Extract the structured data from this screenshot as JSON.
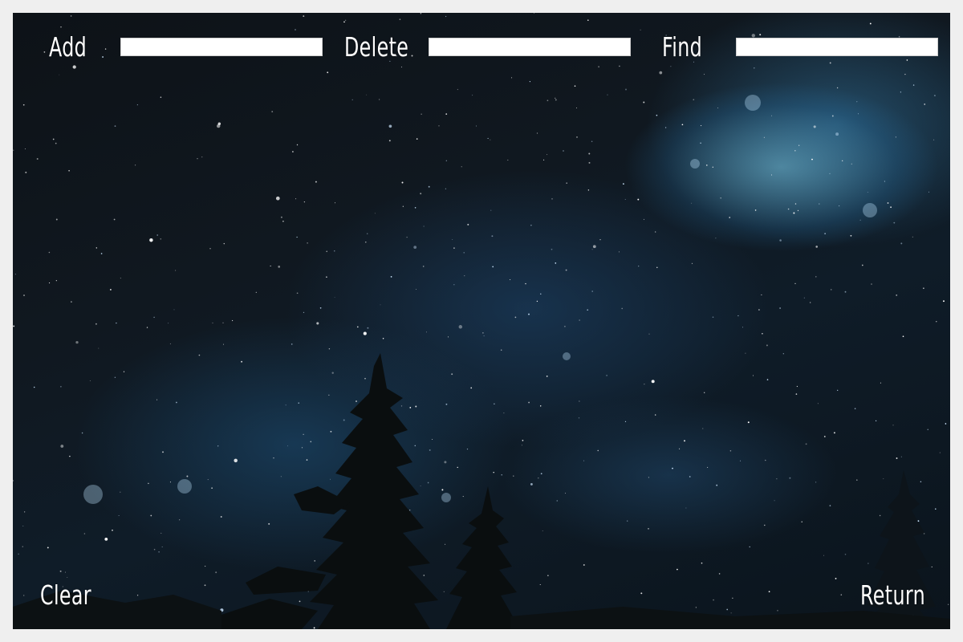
{
  "toolbar": {
    "add_label": "Add",
    "add_value": "",
    "delete_label": "Delete",
    "delete_value": "",
    "find_label": "Find",
    "find_value": ""
  },
  "footer": {
    "clear_label": "Clear",
    "return_label": "Return"
  },
  "colors": {
    "page_border": "#efefef",
    "sky_dark": "#0d1217",
    "nebula": "#4aa6d6",
    "text": "#ffffff",
    "field_bg": "#ffffff"
  }
}
